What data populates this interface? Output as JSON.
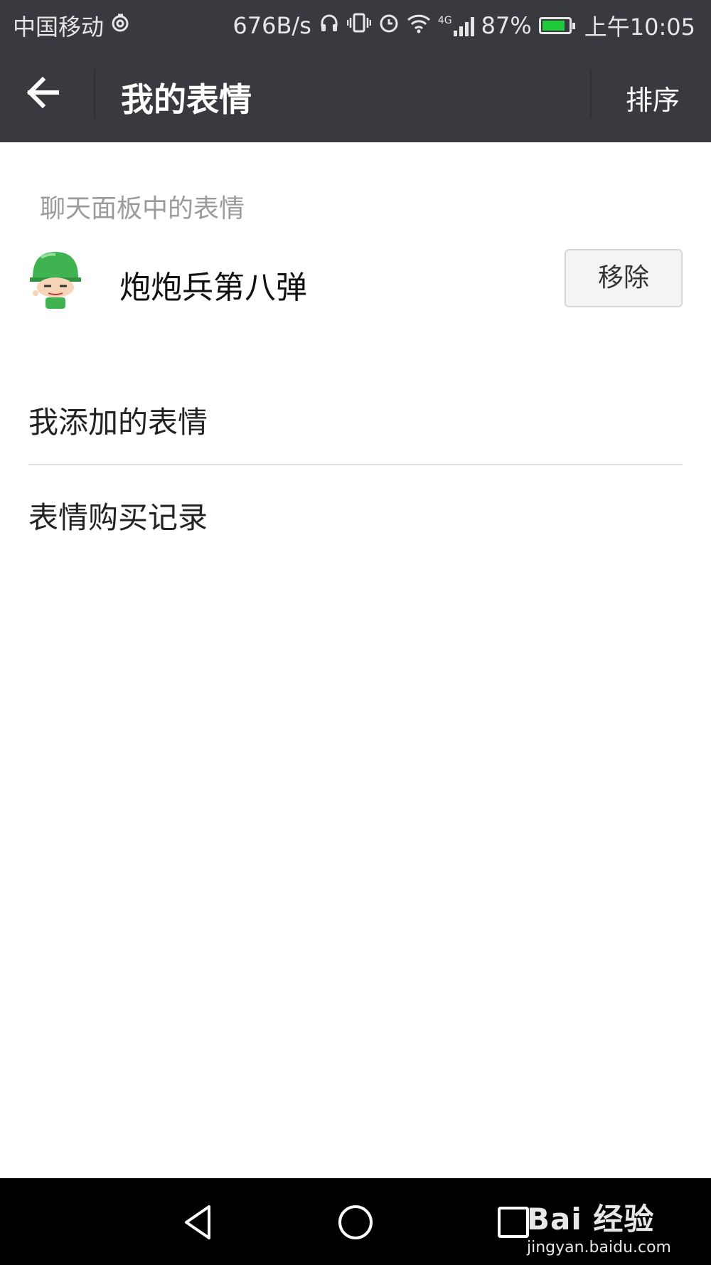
{
  "status_bar": {
    "carrier": "中国移动",
    "net_speed": "676B/s",
    "network_type": "4G",
    "battery": "87%",
    "battery_level": 0.87,
    "time": "上午10:05",
    "icons": [
      "sync-icon",
      "headphones-icon",
      "vibrate-icon",
      "alarm-icon",
      "wifi-icon",
      "signal-icon",
      "battery-charging-icon"
    ]
  },
  "title_bar": {
    "title": "我的表情",
    "sort_label": "排序",
    "back_icon": "back-arrow-icon"
  },
  "chat_panel": {
    "section_label": "聊天面板中的表情",
    "packs": [
      {
        "name": "炮炮兵第八弹",
        "action_label": "移除",
        "icon": "soldier-sticker-icon"
      }
    ]
  },
  "menu": {
    "items": [
      {
        "label": "我添加的表情"
      },
      {
        "label": "表情购买记录"
      }
    ]
  },
  "nav_bar": {
    "icons": [
      "back-triangle-icon",
      "home-circle-icon",
      "recents-square-icon"
    ]
  },
  "watermark": {
    "brand": "Bai 经验",
    "url": "jingyan.baidu.com"
  },
  "colors": {
    "bar_bg": "#393a3f",
    "battery_fill": "#1fcb3b",
    "section_label": "#9b9b9b",
    "helmet_green": "#3fb34f"
  }
}
